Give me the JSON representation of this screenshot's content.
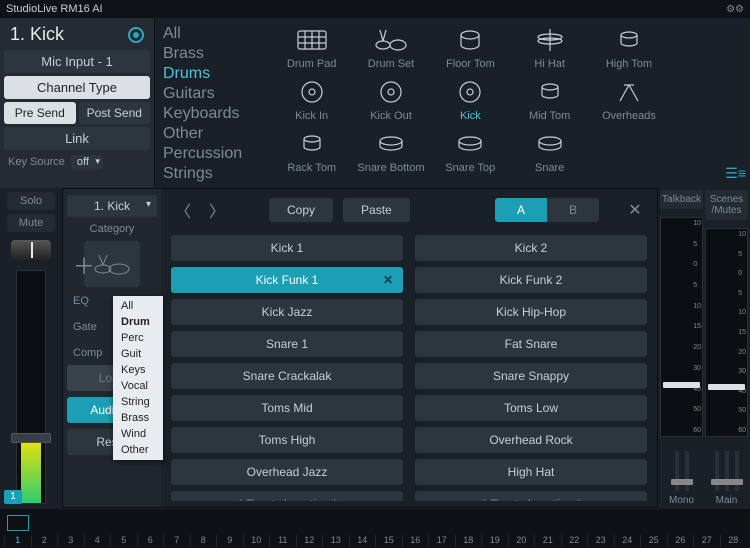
{
  "title": "StudioLive RM16 AI",
  "channel": {
    "number_label": "1. Kick",
    "mic_input": "Mic Input - 1",
    "channel_type": "Channel Type",
    "pre_send": "Pre Send",
    "post_send": "Post Send",
    "link": "Link",
    "key_source_label": "Key Source",
    "key_source_value": "off"
  },
  "categories": [
    "All",
    "Brass",
    "Drums",
    "Guitars",
    "Keyboards",
    "Other",
    "Percussion",
    "Strings"
  ],
  "categories_selected": "Drums",
  "instrument_grid": [
    {
      "label": "Drum Pad",
      "icon": "drumpad"
    },
    {
      "label": "Drum Set",
      "icon": "drumset"
    },
    {
      "label": "Floor Tom",
      "icon": "floortom"
    },
    {
      "label": "Hi Hat",
      "icon": "hihat"
    },
    {
      "label": "High Tom",
      "icon": "hightom"
    },
    {
      "label": "",
      "icon": ""
    },
    {
      "label": "Kick In",
      "icon": "kickin"
    },
    {
      "label": "Kick Out",
      "icon": "kickout"
    },
    {
      "label": "Kick",
      "icon": "kick",
      "selected": true
    },
    {
      "label": "Mid Tom",
      "icon": "midtom"
    },
    {
      "label": "Overheads",
      "icon": "overheads"
    },
    {
      "label": "",
      "icon": ""
    },
    {
      "label": "Rack Tom",
      "icon": "racktom"
    },
    {
      "label": "Snare Bottom",
      "icon": "snarebottom"
    },
    {
      "label": "Snare Top",
      "icon": "snaretop"
    },
    {
      "label": "Snare",
      "icon": "snare"
    },
    {
      "label": "",
      "icon": ""
    },
    {
      "label": "",
      "icon": ""
    }
  ],
  "left_strip": {
    "solo": "Solo",
    "mute": "Mute",
    "channel_num": "1"
  },
  "right_strip": {
    "talkback": "Talkback",
    "scenes": "Scenes /Mutes",
    "mono": "Mono",
    "main": "Main",
    "scale": [
      "10",
      "5",
      "0",
      "5",
      "10",
      "15",
      "20",
      "30",
      "40",
      "50",
      "60"
    ]
  },
  "overlay": {
    "channel_dd": "1. Kick",
    "category_label": "Category",
    "proc": [
      "EQ",
      "Gate",
      "Comp"
    ],
    "load": "Load",
    "audition": "Audition",
    "reset": "Reset",
    "copy": "Copy",
    "paste": "Paste",
    "a": "A",
    "b": "B",
    "presets": [
      [
        "Kick 1",
        "Kick 2"
      ],
      [
        "Kick Funk 1",
        "Kick Funk 2"
      ],
      [
        "Kick Jazz",
        "Kick Hip-Hop"
      ],
      [
        "Snare 1",
        "Fat Snare"
      ],
      [
        "Snare Crackalak",
        "Snare Snappy"
      ],
      [
        "Toms Mid",
        "Toms Low"
      ],
      [
        "Toms High",
        "Overhead Rock"
      ],
      [
        "Overhead Jazz",
        "High Hat"
      ],
      [
        "* Empty Location *",
        "* Empty Location *"
      ]
    ],
    "selected_preset": "Kick Funk 1"
  },
  "dropdown": {
    "items": [
      "All",
      "Drum",
      "Perc",
      "Guit",
      "Keys",
      "Vocal",
      "String",
      "Brass",
      "Wind",
      "Other"
    ],
    "bold": "Drum"
  },
  "ruler": [
    "1",
    "2",
    "3",
    "4",
    "5",
    "6",
    "7",
    "8",
    "9",
    "10",
    "11",
    "12",
    "13",
    "14",
    "15",
    "16",
    "17",
    "18",
    "19",
    "20",
    "21",
    "22",
    "23",
    "24",
    "25",
    "26",
    "27",
    "28"
  ]
}
